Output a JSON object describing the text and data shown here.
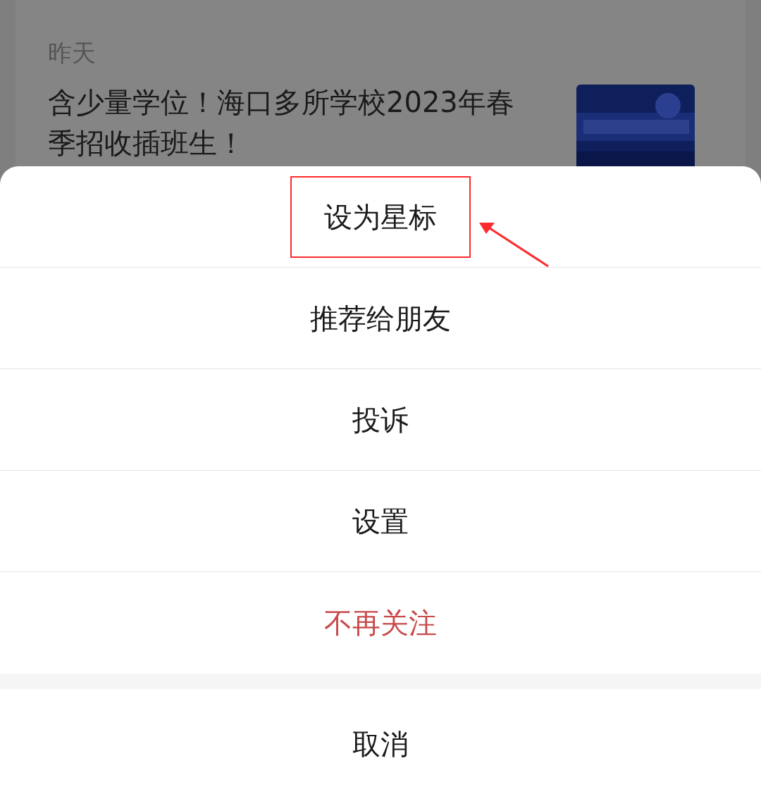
{
  "background": {
    "date": "昨天",
    "headline": "含少量学位！海口多所学校2023年春季招收插班生！"
  },
  "menu": {
    "items": [
      {
        "label": "设为星标",
        "kind": "normal",
        "highlighted": true
      },
      {
        "label": "推荐给朋友",
        "kind": "normal",
        "highlighted": false
      },
      {
        "label": "投诉",
        "kind": "normal",
        "highlighted": false
      },
      {
        "label": "设置",
        "kind": "normal",
        "highlighted": false
      },
      {
        "label": "不再关注",
        "kind": "danger",
        "highlighted": false
      }
    ],
    "cancel": "取消"
  }
}
